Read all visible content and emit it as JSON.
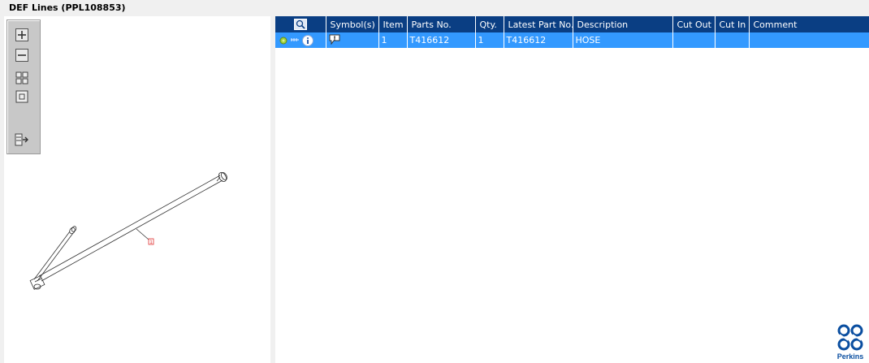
{
  "window": {
    "title": "DEF Lines (PPL108853)"
  },
  "toolbox": {
    "tools": [
      {
        "icon": "zoom-in-icon"
      },
      {
        "icon": "zoom-out-icon"
      },
      {
        "icon": "fit-all-icon"
      },
      {
        "icon": "actual-size-icon"
      },
      {
        "icon": "export-list-icon"
      }
    ]
  },
  "drawing": {
    "callout": "1"
  },
  "table": {
    "headers": {
      "search": "",
      "symbols": "Symbol(s)",
      "item": "Item",
      "parts_no": "Parts No.",
      "qty": "Qty.",
      "latest_part_no": "Latest Part No.",
      "description": "Description",
      "cut_out": "Cut Out",
      "cut_in": "Cut In",
      "comment": "Comment"
    },
    "rows": [
      {
        "item": "1",
        "parts_no": "T416612",
        "qty": "1",
        "latest_part_no": "T416612",
        "description": "HOSE",
        "cut_out": "",
        "cut_in": "",
        "comment": ""
      }
    ]
  },
  "brand": {
    "name": "Perkins",
    "color": "#0a4ea0"
  },
  "colors": {
    "header": "#0a3e83",
    "selected_row": "#3399ff"
  }
}
